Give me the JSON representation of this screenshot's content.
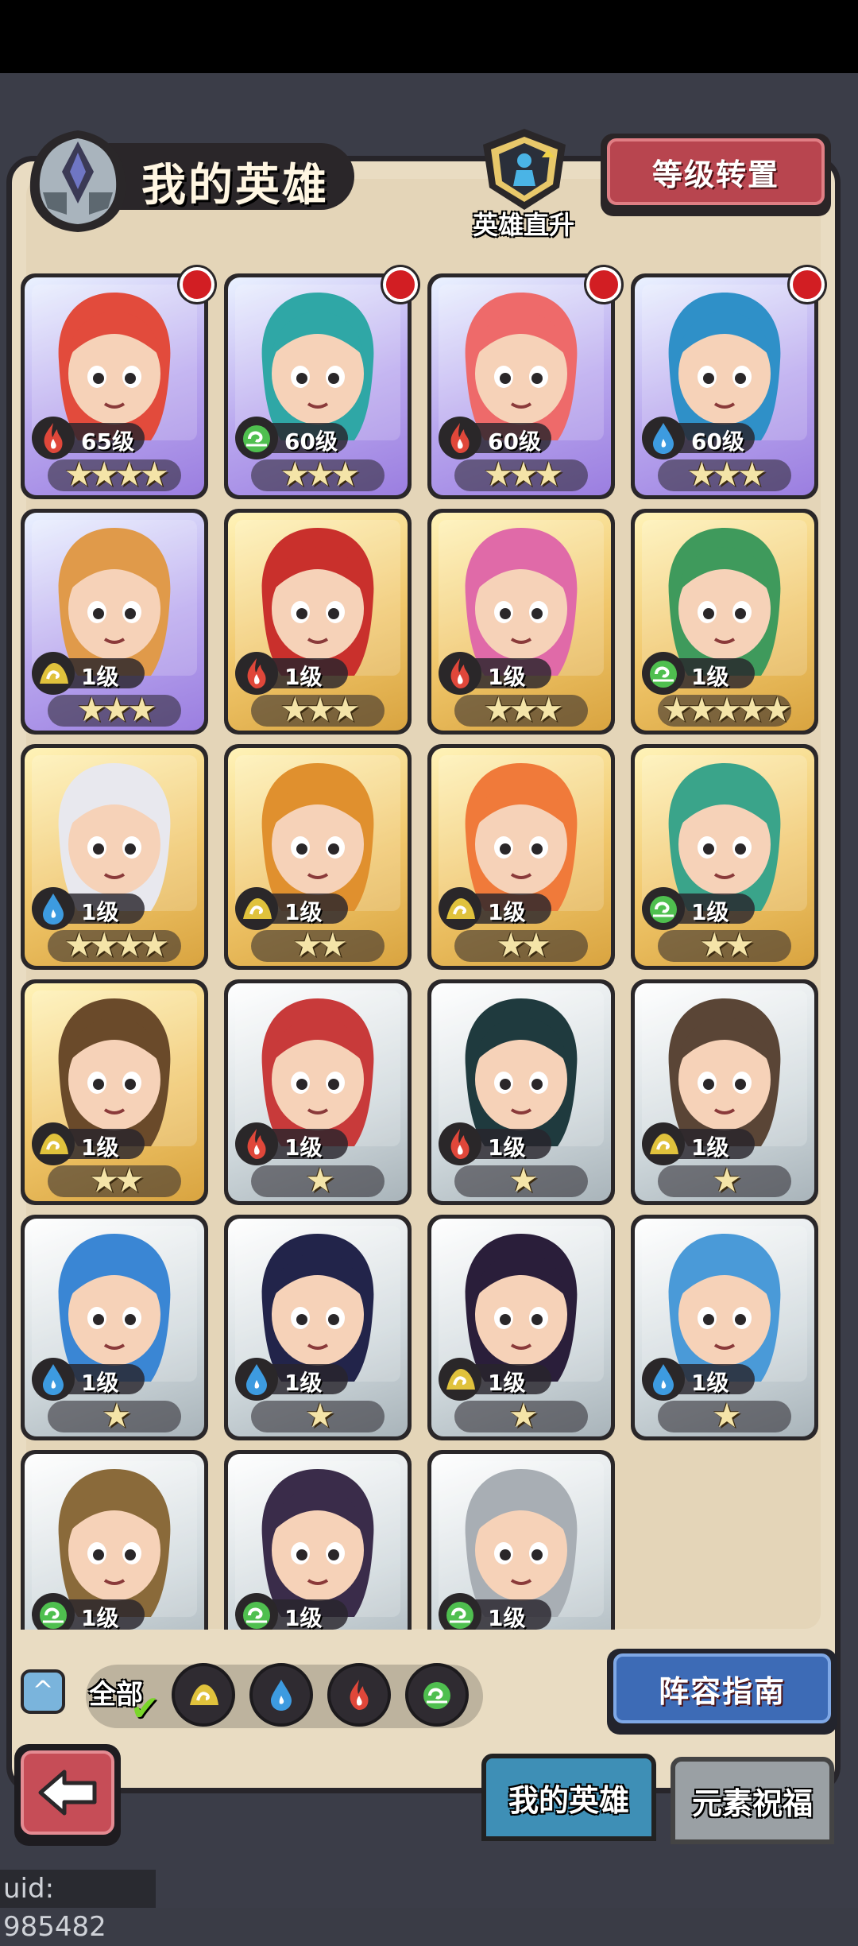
{
  "header": {
    "title": "我的英雄",
    "shortcut_label": "英雄直升",
    "reset_button": "等级转置"
  },
  "heroes": [
    {
      "level": "65级",
      "stars": "★★★★",
      "element": "fire",
      "rarity": "purple",
      "dot": true,
      "hue": "#e24b3c"
    },
    {
      "level": "60级",
      "stars": "★★★",
      "element": "wind",
      "rarity": "purple",
      "dot": true,
      "hue": "#2fa7a6"
    },
    {
      "level": "60级",
      "stars": "★★★",
      "element": "fire",
      "rarity": "purple",
      "dot": true,
      "hue": "#ee6a6a"
    },
    {
      "level": "60级",
      "stars": "★★★",
      "element": "water",
      "rarity": "purple",
      "dot": true,
      "hue": "#2f90c8"
    },
    {
      "level": "1级",
      "stars": "★★★",
      "element": "earth",
      "rarity": "purple",
      "dot": false,
      "hue": "#e09a4a"
    },
    {
      "level": "1级",
      "stars": "★★★",
      "element": "fire",
      "rarity": "gold",
      "dot": false,
      "hue": "#c9302c"
    },
    {
      "level": "1级",
      "stars": "★★★",
      "element": "fire",
      "rarity": "gold",
      "dot": false,
      "hue": "#e06aa8"
    },
    {
      "level": "1级",
      "stars": "★★★★★",
      "element": "wind",
      "rarity": "gold",
      "dot": false,
      "hue": "#3f9a5c"
    },
    {
      "level": "1级",
      "stars": "★★★★",
      "element": "water",
      "rarity": "gold",
      "dot": false,
      "hue": "#e8e8ee"
    },
    {
      "level": "1级",
      "stars": "★★",
      "element": "earth",
      "rarity": "gold",
      "dot": false,
      "hue": "#e0902e"
    },
    {
      "level": "1级",
      "stars": "★★",
      "element": "earth",
      "rarity": "gold",
      "dot": false,
      "hue": "#f07a3a"
    },
    {
      "level": "1级",
      "stars": "★★",
      "element": "wind",
      "rarity": "gold",
      "dot": false,
      "hue": "#3aa48a"
    },
    {
      "level": "1级",
      "stars": "★★",
      "element": "earth",
      "rarity": "gold",
      "dot": false,
      "hue": "#6a4a2a"
    },
    {
      "level": "1级",
      "stars": "★",
      "element": "fire",
      "rarity": "silver",
      "dot": false,
      "hue": "#c83a3a"
    },
    {
      "level": "1级",
      "stars": "★",
      "element": "fire",
      "rarity": "silver",
      "dot": false,
      "hue": "#1f3a3e"
    },
    {
      "level": "1级",
      "stars": "★",
      "element": "earth",
      "rarity": "silver",
      "dot": false,
      "hue": "#5a4536"
    },
    {
      "level": "1级",
      "stars": "★",
      "element": "water",
      "rarity": "silver",
      "dot": false,
      "hue": "#3a86d4"
    },
    {
      "level": "1级",
      "stars": "★",
      "element": "water",
      "rarity": "silver",
      "dot": false,
      "hue": "#22244a"
    },
    {
      "level": "1级",
      "stars": "★",
      "element": "earth",
      "rarity": "silver",
      "dot": false,
      "hue": "#2a1e3a"
    },
    {
      "level": "1级",
      "stars": "★",
      "element": "water",
      "rarity": "silver",
      "dot": false,
      "hue": "#4a9ad8"
    },
    {
      "level": "1级",
      "stars": "",
      "element": "wind",
      "rarity": "silver",
      "dot": false,
      "hue": "#8a6a3a"
    },
    {
      "level": "1级",
      "stars": "",
      "element": "wind",
      "rarity": "silver",
      "dot": false,
      "hue": "#3a2c4a"
    },
    {
      "level": "1级",
      "stars": "",
      "element": "wind",
      "rarity": "silver",
      "dot": false,
      "hue": "#a8aeb4"
    }
  ],
  "filters": {
    "all_label": "全部",
    "elements": [
      "earth",
      "water",
      "fire",
      "wind"
    ]
  },
  "guide_button": "阵容指南",
  "tabs": {
    "active": "我的英雄",
    "inactive": "元素祝福"
  },
  "uid_text": "uid: 985482",
  "colors": {
    "fire": "#e0473a",
    "water": "#3d9be0",
    "wind": "#4fbf4f",
    "earth": "#e0c23c",
    "panel": "#e9dcc2",
    "reddot": "#d21e23"
  }
}
